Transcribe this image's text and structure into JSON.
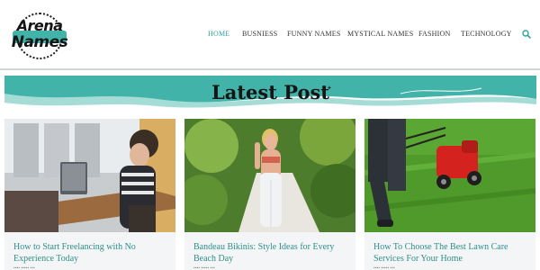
{
  "site": {
    "logo_top": "Arena",
    "logo_bottom": "Names"
  },
  "nav": {
    "items": [
      {
        "label": "HOME",
        "active": true
      },
      {
        "label": "BUSNIESS",
        "active": false
      },
      {
        "label": "FUNNY NAMES",
        "active": false
      },
      {
        "label": "MYSTICAL NAMES",
        "active": false
      },
      {
        "label": "FASHION",
        "active": false
      },
      {
        "label": "TECHNOLOGY",
        "active": false
      }
    ],
    "search_icon": "search-icon"
  },
  "banner": {
    "title": "Latest Post",
    "colors": {
      "teal": "#41b3a8",
      "light_teal": "#a6dcd6"
    }
  },
  "posts": [
    {
      "title": "How to Start Freelancing with No Experience Today"
    },
    {
      "title": "Bandeau Bikinis: Style Ideas for Every Beach Day"
    },
    {
      "title": "How To Choose The Best Lawn Care Services For Your Home"
    }
  ],
  "colors": {
    "accent": "#2fa39a",
    "link": "#2e8f88",
    "card_bg": "#f4f5f6"
  }
}
